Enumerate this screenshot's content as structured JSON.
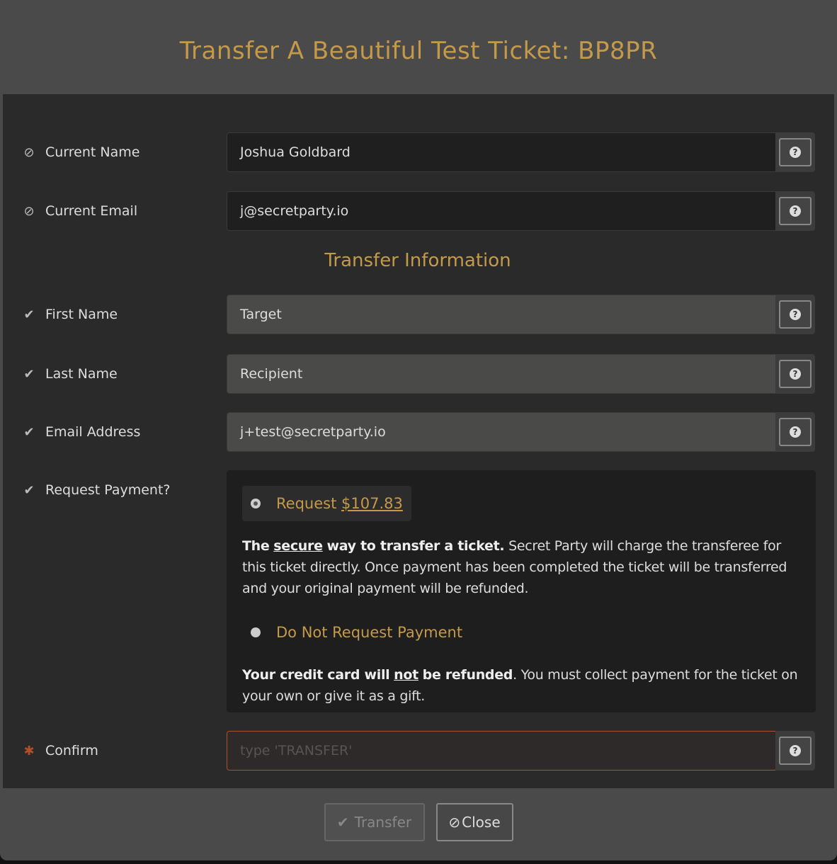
{
  "title": "Transfer A Beautiful Test Ticket: BP8PR",
  "fields": [
    {
      "label": "Current Name",
      "value": "Joshua Goldbard",
      "icon": "ban-icon"
    },
    {
      "label": "Current Email",
      "value": "j@secretparty.io",
      "icon": "ban-icon"
    }
  ],
  "section_title": "Transfer Information",
  "transfer_fields": [
    {
      "label": "First Name",
      "value": "Target",
      "icon": "check-icon"
    },
    {
      "label": "Last Name",
      "value": "Recipient",
      "icon": "check-icon"
    },
    {
      "label": "Email Address",
      "value": "j+test@secretparty.io",
      "icon": "check-icon"
    }
  ],
  "payment": {
    "label": "Request Payment?",
    "request_prefix": "Request",
    "amount": "$107.83",
    "request_desc_b1": "The",
    "request_desc_u": "secure",
    "request_desc_b2": "way to transfer a ticket.",
    "request_desc_rest": "Secret Party will charge the transferee for this ticket directly. Once payment has been completed the ticket will be transferred and your original payment will be refunded.",
    "no_request": "Do Not Request Payment",
    "no_desc_b1": "Your credit card will",
    "no_desc_u": "not",
    "no_desc_b2": "be refunded",
    "no_desc_rest": ". You must collect payment for the ticket on your own or give it as a gift.",
    "selected": "request"
  },
  "confirm": {
    "label": "Confirm",
    "placeholder": "type 'TRANSFER'"
  },
  "help_icon": "?",
  "buttons": {
    "transfer": "Transfer",
    "close": "Close"
  },
  "colors": {
    "accent": "#c49a4a",
    "error": "#b0502a"
  }
}
